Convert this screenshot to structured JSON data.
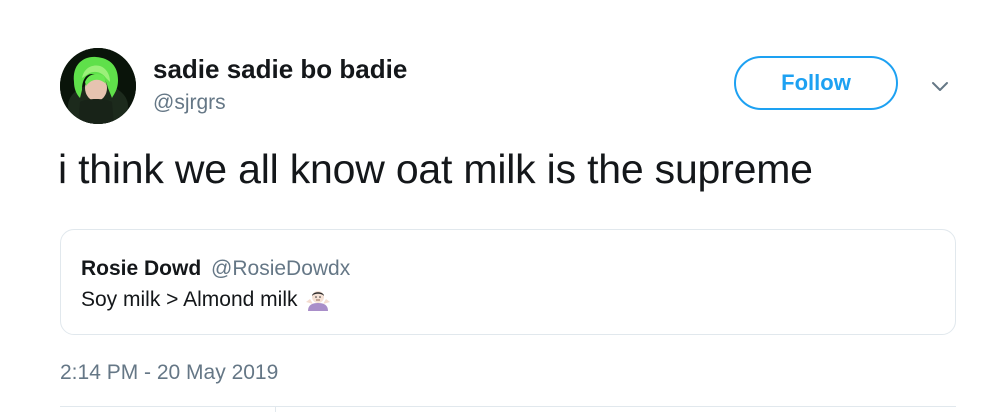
{
  "author": {
    "display_name": "sadie sadie bo badie",
    "handle": "@sjrgrs",
    "avatar_icon": "profile-photo-green-hair"
  },
  "actions": {
    "follow_label": "Follow",
    "menu_icon": "chevron-down-icon"
  },
  "tweet": {
    "text": "i think we all know oat milk is the supreme",
    "timestamp": "2:14 PM - 20 May 2019"
  },
  "quoted_tweet": {
    "display_name": "Rosie Dowd",
    "handle": "@RosieDowdx",
    "text": "Soy milk > Almond milk",
    "emoji_icon": "shrugging-person-emoji"
  },
  "colors": {
    "accent": "#1da1f2",
    "text_primary": "#14171a",
    "text_secondary": "#657786",
    "border": "#e1e8ed"
  }
}
